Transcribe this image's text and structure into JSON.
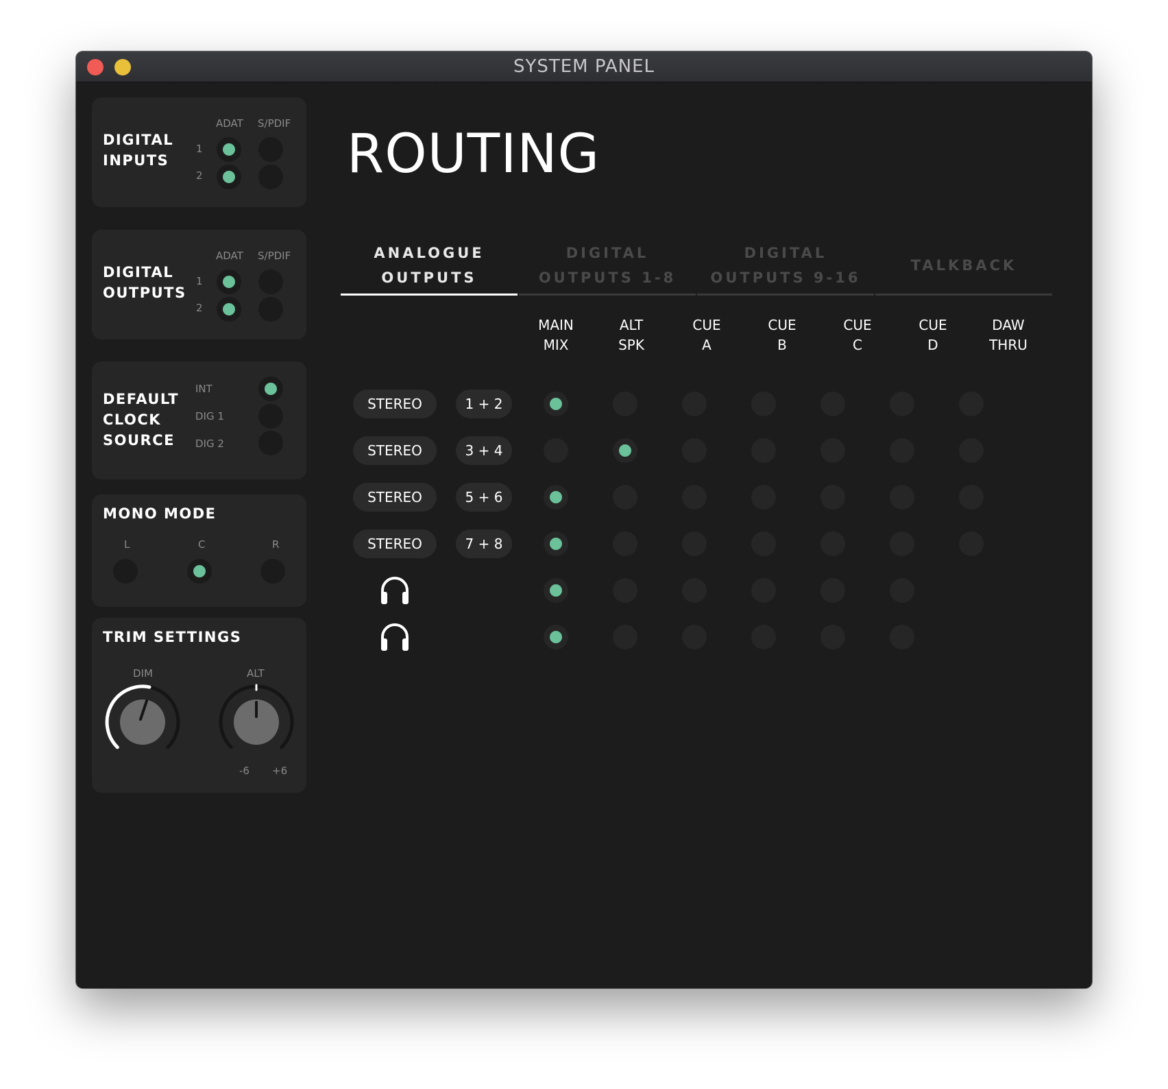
{
  "window": {
    "title": "SYSTEM PANEL"
  },
  "sidebar": {
    "digital_inputs": {
      "label": "DIGITAL INPUTS",
      "col_adat": "ADAT",
      "col_spdif": "S/PDIF",
      "row1": "1",
      "row2": "2",
      "adat_on": [
        true,
        true
      ],
      "spdif_on": [
        false,
        false
      ]
    },
    "digital_outputs": {
      "label": "DIGITAL OUTPUTS",
      "col_adat": "ADAT",
      "col_spdif": "S/PDIF",
      "row1": "1",
      "row2": "2",
      "adat_on": [
        true,
        true
      ],
      "spdif_on": [
        false,
        false
      ]
    },
    "clock": {
      "label": "DEFAULT CLOCK SOURCE",
      "opt_int": "INT",
      "opt_dig1": "DIG 1",
      "opt_dig2": "DIG 2",
      "selected": "INT"
    },
    "mono": {
      "label": "MONO MODE",
      "l": "L",
      "c": "C",
      "r": "R",
      "selected": "C"
    },
    "trim": {
      "label": "TRIM SETTINGS",
      "dim": "DIM",
      "alt": "ALT",
      "min": "-6",
      "max": "+6"
    }
  },
  "routing": {
    "title": "ROUTING",
    "tabs": [
      {
        "label": "ANALOGUE\nOUTPUTS",
        "active": true
      },
      {
        "label": "DIGITAL\nOUTPUTS 1-8",
        "active": false
      },
      {
        "label": "DIGITAL\nOUTPUTS 9-16",
        "active": false
      },
      {
        "label": "TALKBACK",
        "active": false
      }
    ],
    "columns": [
      "MAIN\nMIX",
      "ALT\nSPK",
      "CUE\nA",
      "CUE\nB",
      "CUE\nC",
      "CUE\nD",
      "DAW\nTHRU"
    ],
    "rows": [
      {
        "mode": "STEREO",
        "channels": "1 + 2",
        "routes": [
          1,
          0,
          0,
          0,
          0,
          0,
          0
        ]
      },
      {
        "mode": "STEREO",
        "channels": "3 + 4",
        "routes": [
          0,
          1,
          0,
          0,
          0,
          0,
          0
        ]
      },
      {
        "mode": "STEREO",
        "channels": "5 + 6",
        "routes": [
          1,
          0,
          0,
          0,
          0,
          0,
          0
        ]
      },
      {
        "mode": "STEREO",
        "channels": "7 + 8",
        "routes": [
          1,
          0,
          0,
          0,
          0,
          0,
          0
        ]
      },
      {
        "mode": "headphones-icon",
        "channels": "",
        "routes": [
          1,
          0,
          0,
          0,
          0,
          0
        ]
      },
      {
        "mode": "headphones-icon",
        "channels": "",
        "routes": [
          1,
          0,
          0,
          0,
          0,
          0
        ]
      }
    ],
    "accent_color": "#6bc19a"
  }
}
